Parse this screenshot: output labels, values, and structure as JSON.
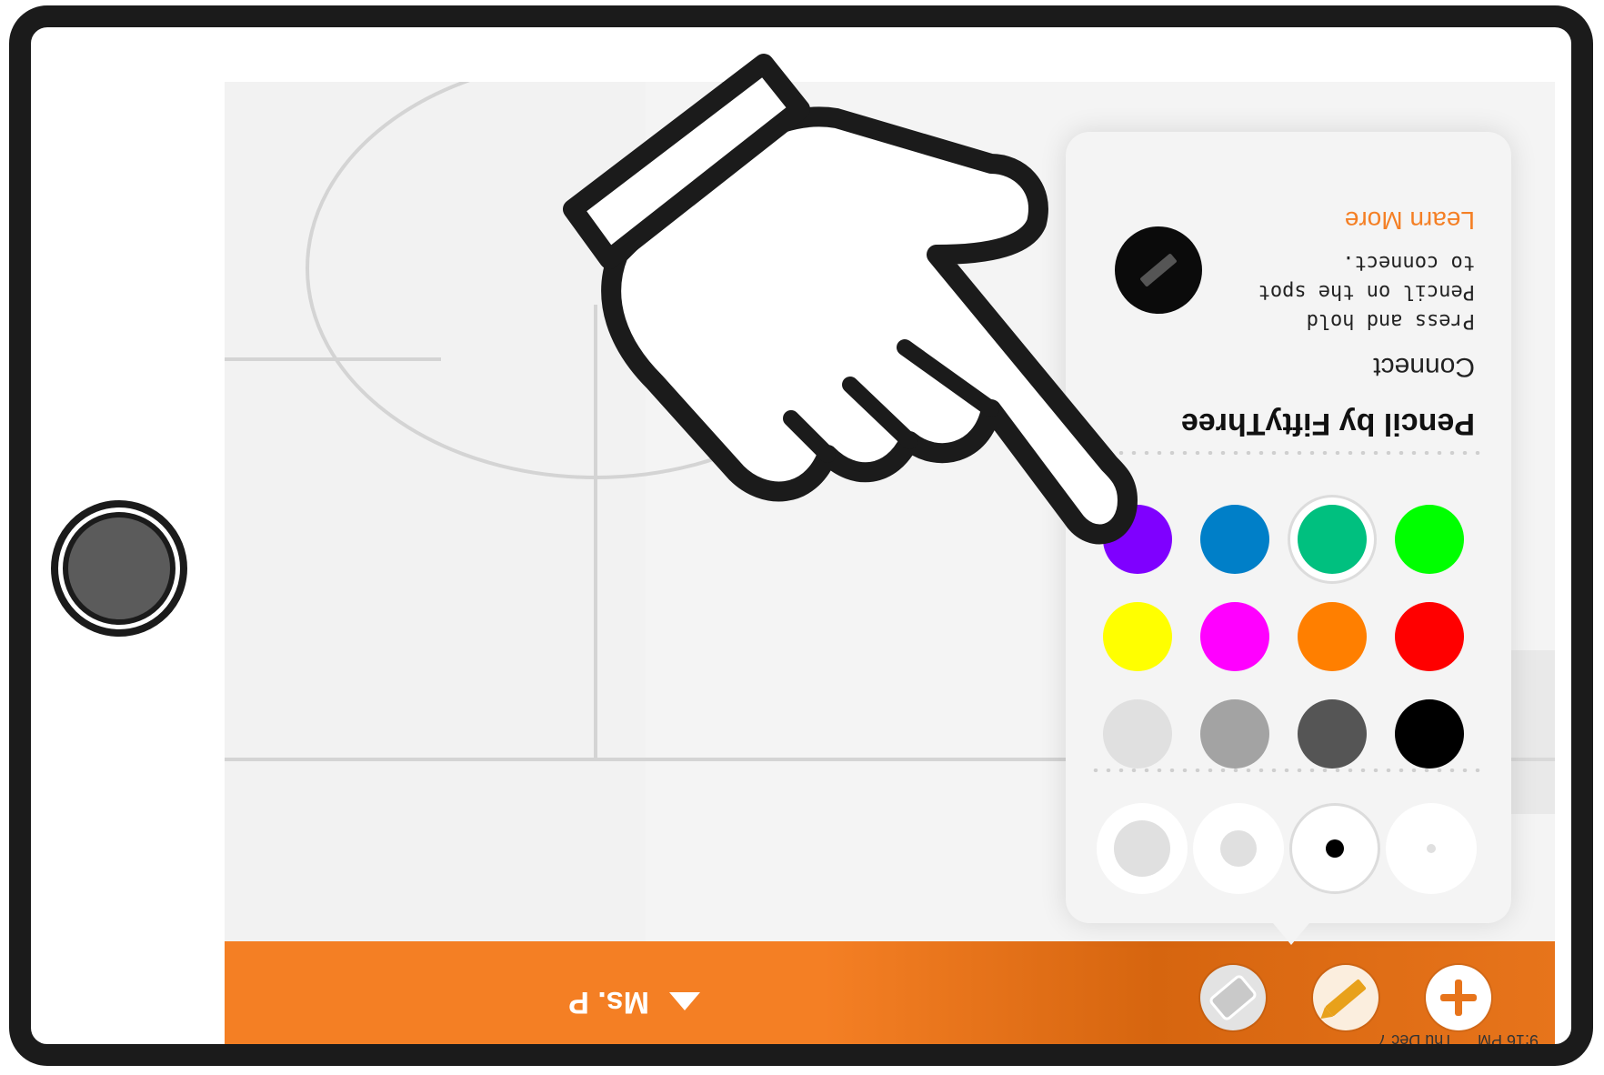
{
  "status_bar": {
    "time": "9:16 PM",
    "date": "Thu Dec 7"
  },
  "toolbar": {
    "user_name": "Ms. P",
    "add_icon": "plus-icon",
    "pencil_icon": "pencil-icon",
    "eraser_icon": "eraser-icon",
    "accent": "#f47f24"
  },
  "popover": {
    "sizes": [
      {
        "name": "extra-small",
        "selected": false
      },
      {
        "name": "small",
        "selected": true
      },
      {
        "name": "medium",
        "selected": false
      },
      {
        "name": "large",
        "selected": false
      }
    ],
    "colors": [
      {
        "hex": "#000000",
        "selected": false
      },
      {
        "hex": "#555555",
        "selected": false
      },
      {
        "hex": "#a3a3a3",
        "selected": false
      },
      {
        "hex": "#e0e0e0",
        "selected": false
      },
      {
        "hex": "#ff0000",
        "selected": false
      },
      {
        "hex": "#ff7f00",
        "selected": false
      },
      {
        "hex": "#ff00ff",
        "selected": false
      },
      {
        "hex": "#ffff00",
        "selected": false
      },
      {
        "hex": "#00ff00",
        "selected": false
      },
      {
        "hex": "#00c07f",
        "selected": true
      },
      {
        "hex": "#007fc8",
        "selected": false
      },
      {
        "hex": "#7f00ff",
        "selected": false
      }
    ],
    "pencil_title": "Pencil by FiftyThree",
    "connect_title": "Connect",
    "connect_description": "Press and hold Pencil on the spot to connect.",
    "learn_more": "Learn More"
  },
  "overlay": {
    "hand_icon": "pointing-hand-icon"
  }
}
